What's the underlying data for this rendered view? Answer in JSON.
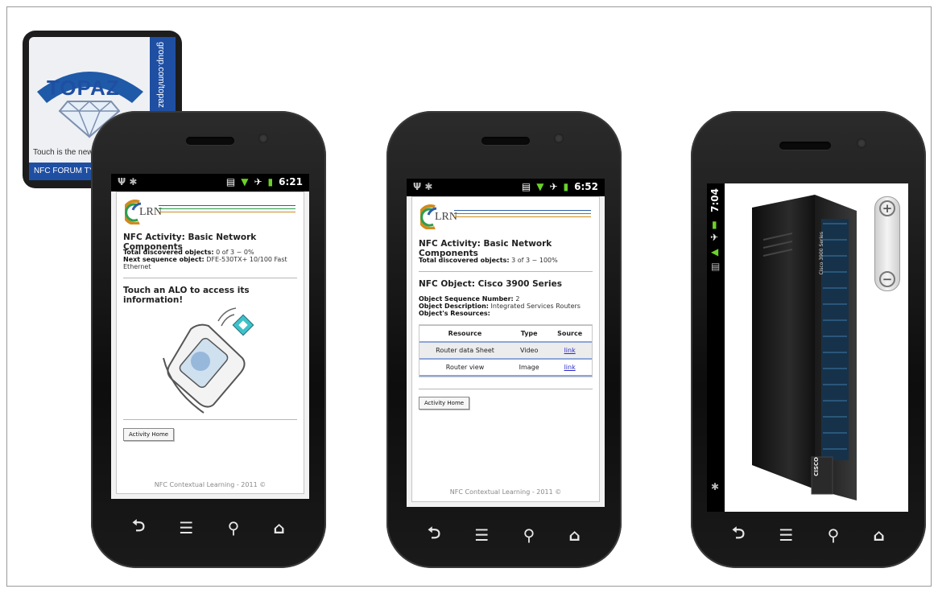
{
  "tag": {
    "brand": "TOPAZ",
    "url_text": "group.com/topaz",
    "caption": "Touch is the new",
    "bottom_text": "NFC FORUM TYI"
  },
  "phone1": {
    "time": "6:21",
    "logo_text": "LRN",
    "heading": "NFC Activity: Basic Network Components",
    "total_label": "Total discovered objects:",
    "total_value": "0 of 3 ~ 0%",
    "next_label": "Next sequence object:",
    "next_value": "DFE-530TX+ 10/100 Fast Ethernet",
    "prompt": "Touch an ALO to access its information!",
    "button": "Activity Home",
    "footer": "NFC Contextual Learning - 2011 ©"
  },
  "phone2": {
    "time": "6:52",
    "logo_text": "LRN",
    "heading": "NFC Activity: Basic Network Components",
    "total_label": "Total discovered objects:",
    "total_value": "3 of 3 ~ 100%",
    "object_heading": "NFC Object: Cisco 3900 Series",
    "seq_label": "Object Sequence Number:",
    "seq_value": "2",
    "desc_label": "Object Description:",
    "desc_value": "Integrated Services Routers",
    "resources_label": "Object's Resources:",
    "table": {
      "headers": [
        "Resource",
        "Type",
        "Source"
      ],
      "rows": [
        {
          "resource": "Router data Sheet",
          "type": "Video",
          "source": "link"
        },
        {
          "resource": "Router view",
          "type": "Image",
          "source": "link"
        }
      ]
    },
    "button": "Activity Home",
    "footer": "NFC Contextual Learning - 2011 ©"
  },
  "phone3": {
    "time": "7:04",
    "device_label": "Cisco 3900 Series",
    "device_brand": "CISCO"
  },
  "nav": {
    "back": "⮌",
    "menu": "☰",
    "search": "⚲",
    "home": "⌂"
  }
}
